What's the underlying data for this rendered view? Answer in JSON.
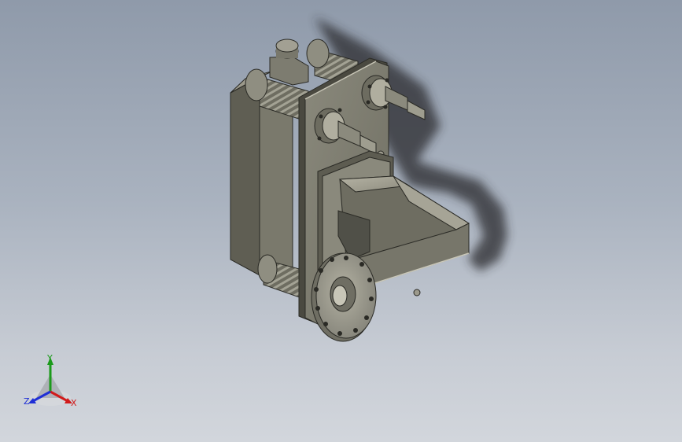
{
  "viewport": {
    "background_top": "#8f9aaa",
    "background_bottom": "#d2d6dc"
  },
  "triad": {
    "x_label": "X",
    "y_label": "Y",
    "z_label": "Z",
    "x_color": "#d11a1a",
    "y_color": "#1b9a1b",
    "z_color": "#1f2fd6"
  }
}
